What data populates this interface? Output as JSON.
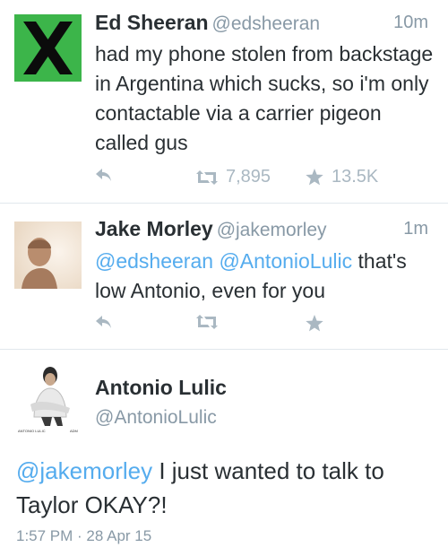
{
  "tweets": [
    {
      "name": "Ed Sheeran",
      "handle": "@edsheeran",
      "time": "10m",
      "text": "had my phone stolen from backstage in Argentina which sucks, so i'm only contactable via a carrier pigeon called gus",
      "retweets": "7,895",
      "favorites": "13.5K",
      "avatar_color": "#3cb54a"
    },
    {
      "name": "Jake Morley",
      "handle": "@jakemorley",
      "time": "1m",
      "mention1": "@edsheeran",
      "mention2": "@AntonioLulic",
      "text_rest": " that's low Antonio, even for you",
      "retweets": "",
      "favorites": ""
    }
  ],
  "detail": {
    "name": "Antonio Lulic",
    "handle": "@AntonioLulic",
    "mention": "@jakemorley",
    "text_rest": " I just wanted to talk to Taylor OKAY?!",
    "timestamp": "1:57 PM · 28 Apr 15",
    "avatar_caption_left": "ANTONIO LULIC",
    "avatar_caption_right": "ADM"
  },
  "colors": {
    "link": "#55acee",
    "muted": "#8899a6",
    "action": "#aab8c2"
  }
}
